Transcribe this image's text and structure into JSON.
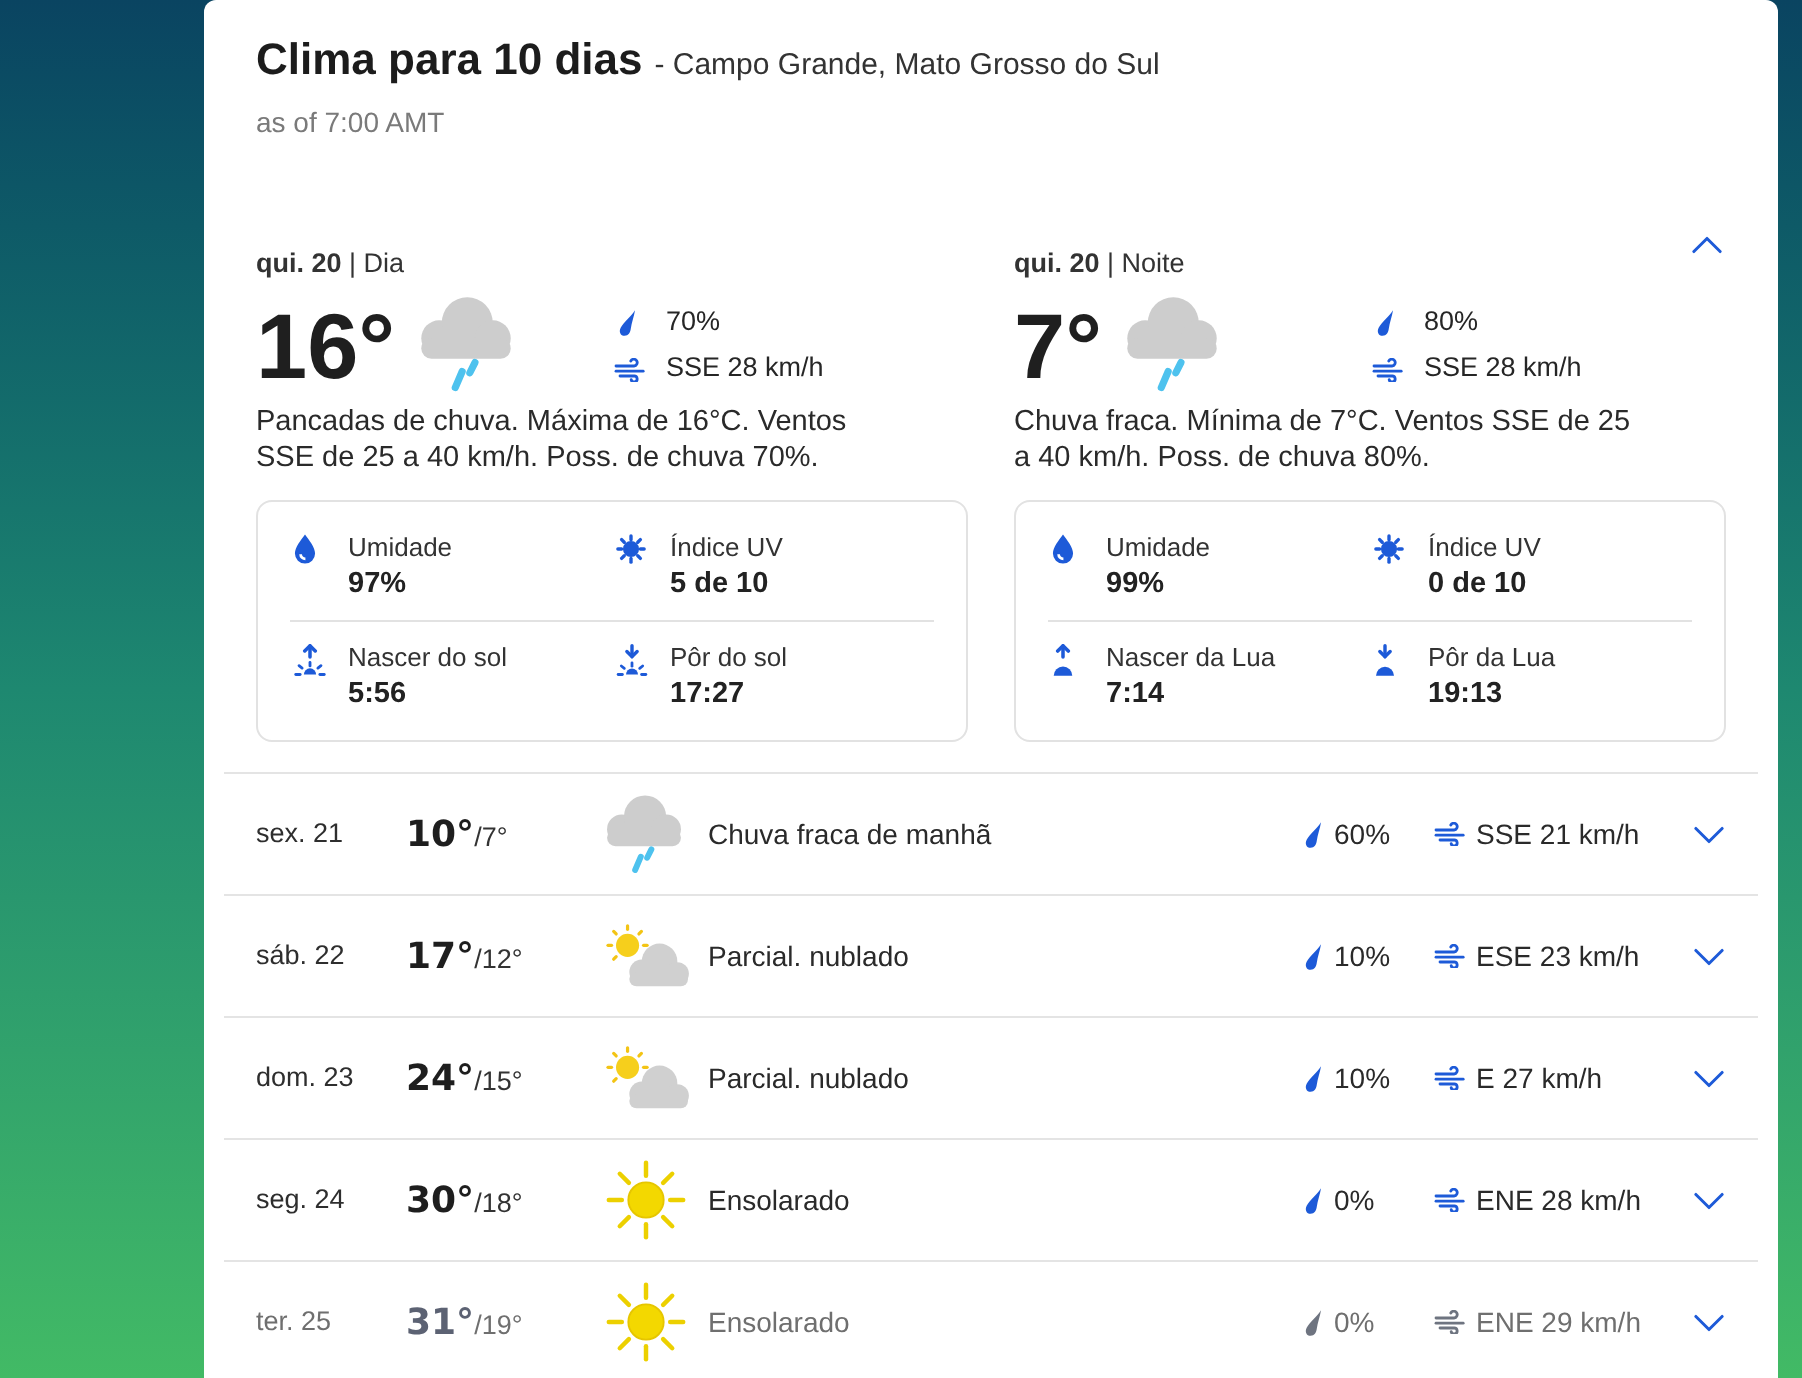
{
  "header": {
    "title": "Clima para 10 dias",
    "location": "- Campo Grande, Mato Grosso do Sul",
    "updated": "as of 7:00 AMT"
  },
  "today": {
    "expanded": true,
    "periods": [
      {
        "heading": "**qui. 20** | Dia",
        "temperature": "16°",
        "kind": "rain",
        "precipitation": "70%",
        "wind": "SSE 28 km/h",
        "description": "Pancadas de chuva. Máxima de 16°C. Ventos SSE de 25 a 40 km/h. Poss. de chuva 70%.",
        "details": [
          {
            "kind": "humidity",
            "label": "Umidade",
            "value": "97%"
          },
          {
            "kind": "uv",
            "label": "Índice UV",
            "value": "5 de 10"
          },
          {
            "kind": "sunrise",
            "label": "Nascer do sol",
            "value": "5:56"
          },
          {
            "kind": "sunset",
            "label": "Pôr do sol",
            "value": "17:27"
          }
        ]
      },
      {
        "heading": "**qui. 20** | Noite",
        "temperature": "7°",
        "kind": "rain",
        "precipitation": "80%",
        "wind": "SSE 28 km/h",
        "description": "Chuva fraca. Mínima de 7°C. Ventos SSE de 25 a 40 km/h. Poss. de chuva 80%.",
        "details": [
          {
            "kind": "humidity",
            "label": "Umidade",
            "value": "99%"
          },
          {
            "kind": "uv",
            "label": "Índice UV",
            "value": "0 de 10"
          },
          {
            "kind": "moonrise",
            "label": "Nascer da Lua",
            "value": "7:14"
          },
          {
            "kind": "moonset",
            "label": "Pôr da Lua",
            "value": "19:13"
          }
        ]
      }
    ]
  },
  "days": [
    {
      "date": "sex. 21",
      "high": "10°",
      "low": "/7°",
      "kind": "rain",
      "summary": "Chuva fraca de manhã",
      "precipitation": "60%",
      "wind": "SSE 21 km/h",
      "expanded": false,
      "faded": false
    },
    {
      "date": "sáb. 22",
      "high": "17°",
      "low": "/12°",
      "kind": "partly_cloudy",
      "summary": "Parcial. nublado",
      "precipitation": "10%",
      "wind": "ESE 23 km/h",
      "expanded": false,
      "faded": false
    },
    {
      "date": "dom. 23",
      "high": "24°",
      "low": "/15°",
      "kind": "partly_cloudy",
      "summary": "Parcial. nublado",
      "precipitation": "10%",
      "wind": "E 27 km/h",
      "expanded": false,
      "faded": false
    },
    {
      "date": "seg. 24",
      "high": "30°",
      "low": "/18°",
      "kind": "sunny",
      "summary": "Ensolarado",
      "precipitation": "0%",
      "wind": "ENE 28 km/h",
      "expanded": false,
      "faded": false
    },
    {
      "date": "ter. 25",
      "high": "31°",
      "low": "/19°",
      "kind": "sunny",
      "summary": "Ensolarado",
      "precipitation": "0%",
      "wind": "ENE 29 km/h",
      "expanded": false,
      "faded": true
    }
  ]
}
